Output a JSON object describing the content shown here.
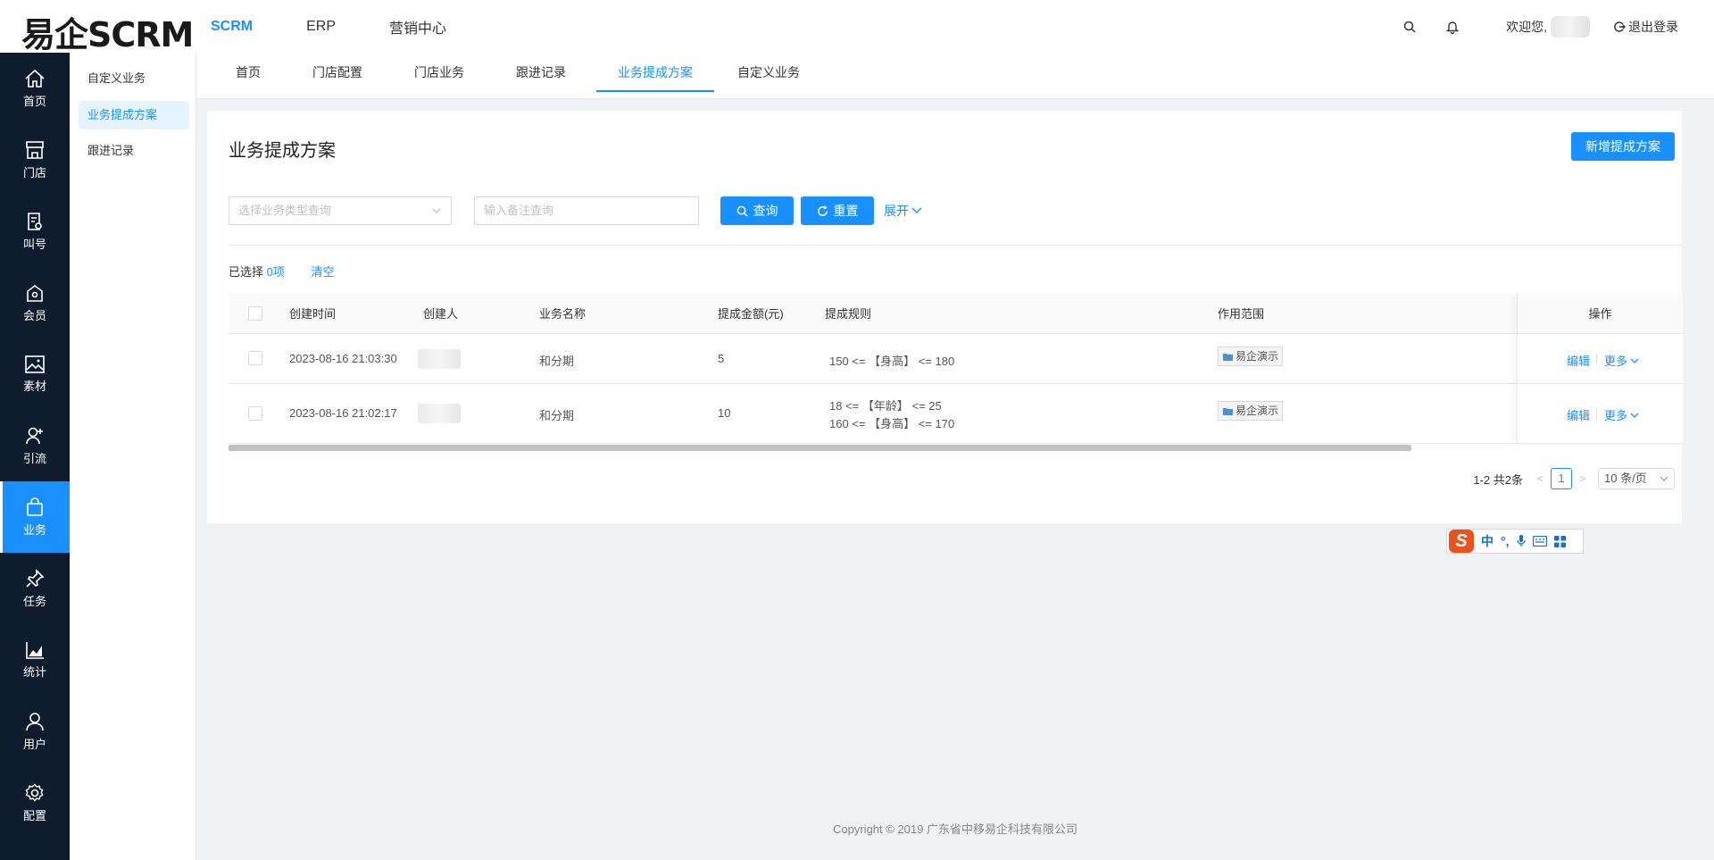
{
  "header": {
    "logo": "易企SCRM",
    "nav": [
      "SCRM",
      "ERP",
      "营销中心"
    ],
    "welcome": "欢迎您,",
    "logout": "退出登录"
  },
  "sidebar": {
    "items": [
      {
        "label": "首页",
        "icon": "home-icon"
      },
      {
        "label": "门店",
        "icon": "store-icon"
      },
      {
        "label": "叫号",
        "icon": "ticket-icon"
      },
      {
        "label": "会员",
        "icon": "member-icon"
      },
      {
        "label": "素材",
        "icon": "image-icon"
      },
      {
        "label": "引流",
        "icon": "traffic-icon"
      },
      {
        "label": "业务",
        "icon": "bag-icon"
      },
      {
        "label": "任务",
        "icon": "pin-icon"
      },
      {
        "label": "统计",
        "icon": "chart-icon"
      },
      {
        "label": "用户",
        "icon": "user-icon"
      },
      {
        "label": "配置",
        "icon": "gear-icon"
      }
    ],
    "active_index": 6
  },
  "submenu": {
    "items": [
      "自定义业务",
      "业务提成方案",
      "跟进记录"
    ],
    "active_index": 1
  },
  "tabs": {
    "items": [
      "首页",
      "门店配置",
      "门店业务",
      "跟进记录",
      "业务提成方案",
      "自定义业务"
    ],
    "active_index": 4
  },
  "page": {
    "title": "业务提成方案",
    "add_button": "新增提成方案"
  },
  "filters": {
    "type_placeholder": "选择业务类型查询",
    "remark_placeholder": "输入备注查询",
    "query_button": "查询",
    "reset_button": "重置",
    "expand": "展开"
  },
  "selection": {
    "prefix": "已选择",
    "count": "0项",
    "clear": "清空"
  },
  "table": {
    "columns": [
      "创建时间",
      "创建人",
      "业务名称",
      "提成金额(元)",
      "提成规则",
      "作用范围",
      "操作"
    ],
    "rows": [
      {
        "created_at": "2023-08-16 21:03:30",
        "business_name": "和分期",
        "amount": "5",
        "rules": [
          "150 <= 【身高】 <= 180"
        ],
        "scope": "易企演示",
        "edit": "编辑",
        "more": "更多"
      },
      {
        "created_at": "2023-08-16 21:02:17",
        "business_name": "和分期",
        "amount": "10",
        "rules": [
          "18 <= 【年龄】 <= 25",
          "160 <= 【身高】 <= 170"
        ],
        "scope": "易企演示",
        "edit": "编辑",
        "more": "更多"
      }
    ]
  },
  "pagination": {
    "summary": "1-2 共2条",
    "current_page": "1",
    "page_size": "10 条/页"
  },
  "ime": {
    "logo": "S",
    "lang": "中",
    "punct": "°,"
  },
  "footer": {
    "copyright": "Copyright © 2019 广东省中移易企科技有限公司"
  },
  "colors": {
    "primary": "#1890ff",
    "sidebar_bg": "#0f1c2d",
    "page_bg": "#f0f2f5"
  }
}
